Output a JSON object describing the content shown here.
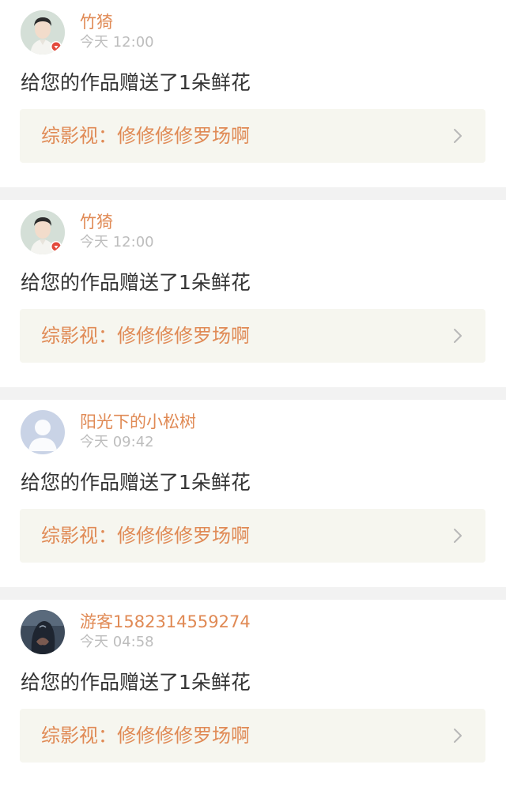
{
  "feed": {
    "items": [
      {
        "username": "竹猗",
        "time": "今天 12:00",
        "action": "给您的作品赠送了1朵鲜花",
        "work_title": "综影视：修修修修罗场啊",
        "avatar": "man-portrait-avatar"
      },
      {
        "username": "竹猗",
        "time": "今天 12:00",
        "action": "给您的作品赠送了1朵鲜花",
        "work_title": "综影视：修修修修罗场啊",
        "avatar": "man-portrait-avatar"
      },
      {
        "username": "阳光下的小松树",
        "time": "今天 09:42",
        "action": "给您的作品赠送了1朵鲜花",
        "work_title": "综影视：修修修修罗场啊",
        "avatar": "default-user-avatar"
      },
      {
        "username": "游客1582314559274",
        "time": "今天 04:58",
        "action": "给您的作品赠送了1朵鲜花",
        "work_title": "综影视：修修修修罗场啊",
        "avatar": "dark-photo-avatar"
      }
    ]
  },
  "colors": {
    "accent": "#e08a55",
    "muted": "#bdbdbd",
    "text": "#333333",
    "link_bg": "#f6f6ef",
    "divider": "#f2f2f2"
  }
}
